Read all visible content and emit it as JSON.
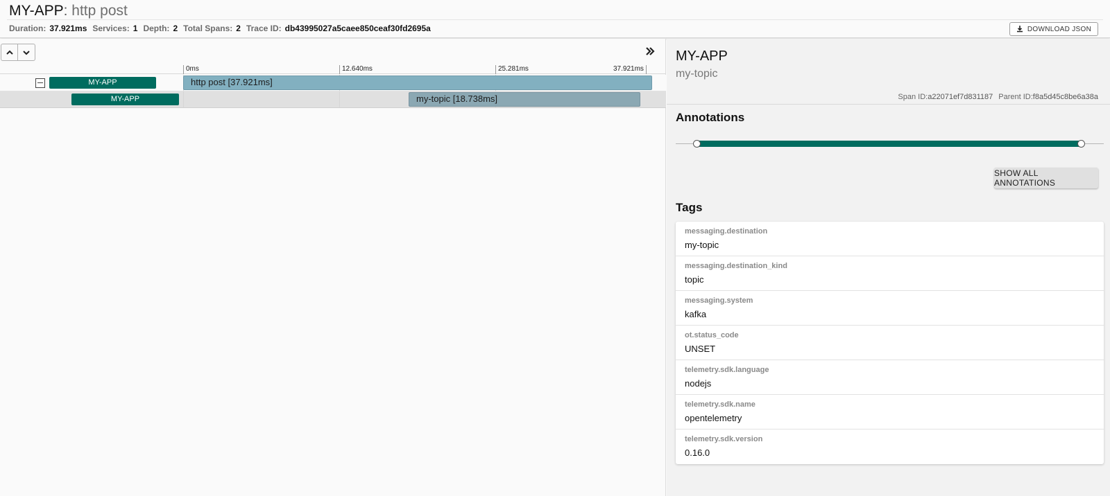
{
  "header": {
    "service": "MY-APP",
    "separator": ":",
    "span_name": "http post",
    "stats": {
      "duration_label": "Duration:",
      "duration": "37.921ms",
      "services_label": "Services:",
      "services": "1",
      "depth_label": "Depth:",
      "depth": "2",
      "total_spans_label": "Total Spans:",
      "total_spans": "2",
      "trace_id_label": "Trace ID:",
      "trace_id": "db43995027a5caee850ceaf30fd2695a"
    },
    "download_label": "DOWNLOAD JSON"
  },
  "timeline": {
    "ticks": [
      "0ms",
      "12.640ms",
      "25.281ms",
      "37.921ms"
    ],
    "rows": [
      {
        "service": "MY-APP",
        "span_label": "http post [37.921ms]"
      },
      {
        "service": "MY-APP",
        "span_label": "my-topic [18.738ms]"
      }
    ]
  },
  "detail": {
    "service": "MY-APP",
    "span_name": "my-topic",
    "span_id_label": "Span ID:",
    "span_id": "a22071ef7d831187",
    "parent_id_label": "Parent ID:",
    "parent_id": "f8a5d45c8be6a38a",
    "annotations_title": "Annotations",
    "show_all_label": "SHOW ALL ANNOTATIONS",
    "tags_title": "Tags",
    "tags": [
      {
        "key": "messaging.destination",
        "value": "my-topic"
      },
      {
        "key": "messaging.destination_kind",
        "value": "topic"
      },
      {
        "key": "messaging.system",
        "value": "kafka"
      },
      {
        "key": "ot.status_code",
        "value": "UNSET"
      },
      {
        "key": "telemetry.sdk.language",
        "value": "nodejs"
      },
      {
        "key": "telemetry.sdk.name",
        "value": "opentelemetry"
      },
      {
        "key": "telemetry.sdk.version",
        "value": "0.16.0"
      }
    ]
  },
  "colors": {
    "service_badge": "#006c5f",
    "span_bar_root": "#82b0c0",
    "span_bar_child": "#8ba8b3"
  },
  "icons": [
    "chevron-up-icon",
    "chevron-down-icon",
    "double-chevron-right-icon",
    "download-icon"
  ]
}
